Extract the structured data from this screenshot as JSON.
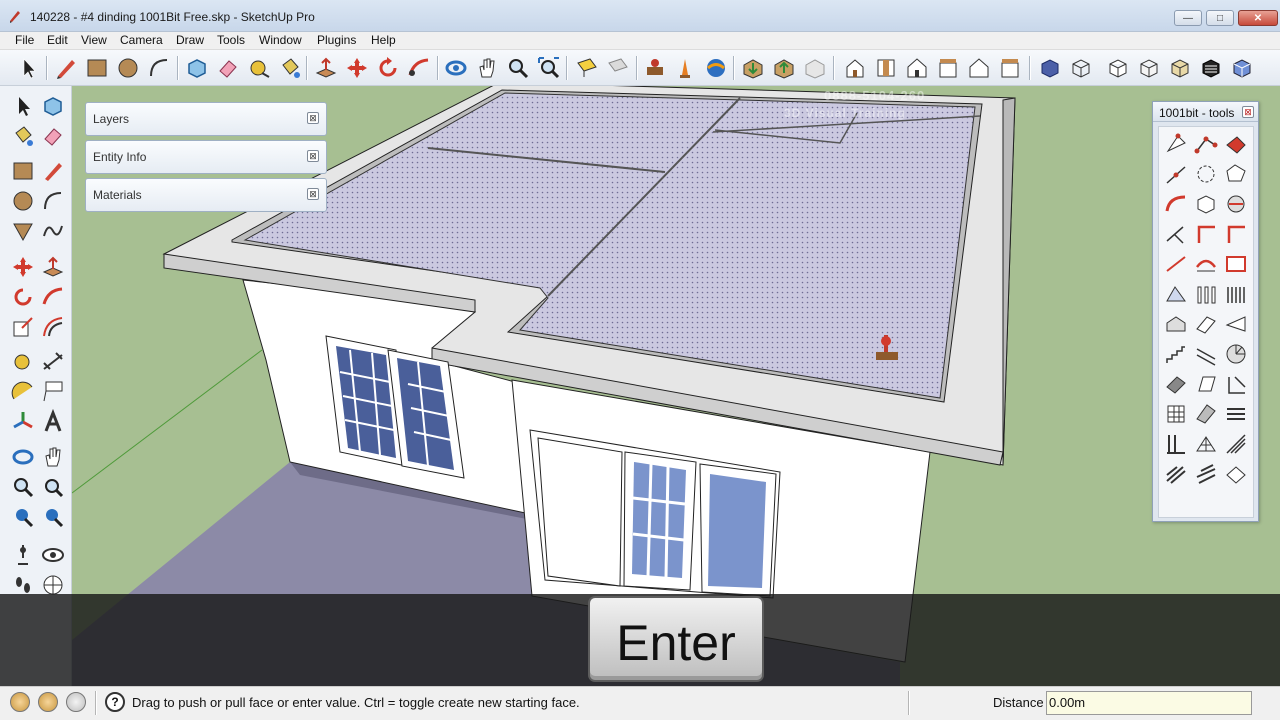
{
  "window": {
    "title": "140228 - #4 dinding 1001Bit Free.skp - SketchUp Pro",
    "minimize_glyph": "—",
    "maximize_glyph": "□",
    "close_glyph": "✕"
  },
  "menu": [
    "File",
    "Edit",
    "View",
    "Camera",
    "Draw",
    "Tools",
    "Window",
    "Plugins",
    "Help"
  ],
  "toolbar": {
    "icons": [
      "select-icon",
      "pencil-icon",
      "rectangle-icon",
      "circle-icon",
      "arc-icon",
      "make-component-icon",
      "eraser-icon",
      "tape-measure-icon",
      "paint-bucket-icon",
      "push-pull-icon",
      "move-icon",
      "rotate-icon",
      "follow-me-icon",
      "orbit-icon",
      "pan-icon",
      "zoom-icon",
      "zoom-extents-icon",
      "section-plane-icon",
      "section-display-icon",
      "add-location-icon",
      "toggle-terrain-icon",
      "get-models-icon",
      "share-model-icon",
      "share-component-icon",
      "extension-warehouse-icon",
      "iso-view-icon",
      "top-view-icon",
      "front-view-icon",
      "right-view-icon",
      "back-view-icon",
      "left-view-icon",
      "xray-icon",
      "wireframe-icon",
      "hidden-line-icon",
      "shaded-icon",
      "shaded-textures-icon",
      "monochrome-icon"
    ]
  },
  "tray": {
    "panels": [
      {
        "label": "Layers",
        "close": "⊠"
      },
      {
        "label": "Entity Info",
        "close": "⊠"
      },
      {
        "label": "Materials",
        "close": "⊠"
      }
    ]
  },
  "tools_window": {
    "title": "1001bit - tools",
    "close": "⊠"
  },
  "watermark": {
    "line1": "0888-5104-260",
    "line2": "3D Visual Training"
  },
  "overlay_key": "Enter",
  "status": {
    "help_glyph": "?",
    "message": "Drag to push or pull face or enter value.  Ctrl = toggle create new starting face.",
    "vcb_label": "Distance",
    "vcb_value": "0.00m"
  },
  "colors": {
    "sky": "#dfe6ee",
    "ground": "#a7bf92",
    "roof": "#c8c6dc",
    "wall": "#ffffff",
    "glass": "#7b94cc"
  }
}
